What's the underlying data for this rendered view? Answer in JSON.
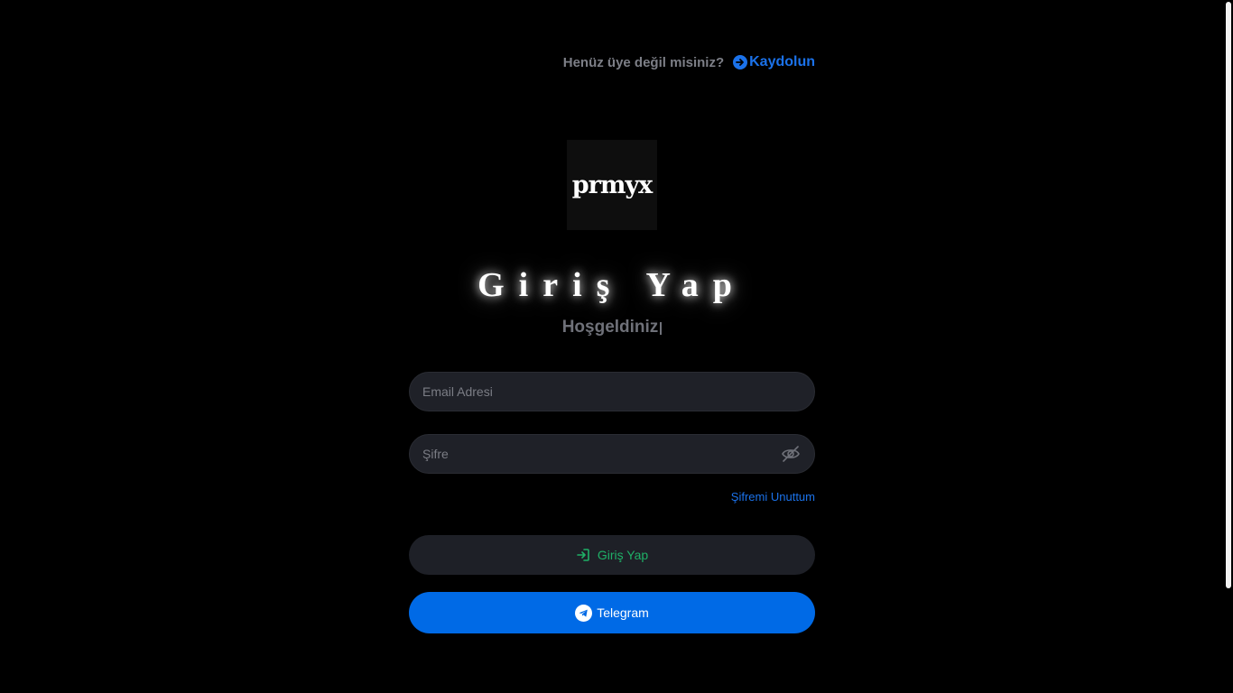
{
  "header": {
    "signup_question": "Henüz üye değil misiniz?",
    "signup_link": "Kaydolun"
  },
  "logo": {
    "text": "prmyx"
  },
  "title": "Giriş Yap",
  "subtitle": "Hoşgeldiniz",
  "form": {
    "email_placeholder": "Email Adresi",
    "email_value": "",
    "password_placeholder": "Şifre",
    "password_value": "",
    "forgot_label": "Şifremi Unuttum",
    "login_label": "Giriş Yap",
    "telegram_label": "Telegram"
  },
  "icons": {
    "signup": "arrow-right-circle-icon",
    "eye": "eye-slash-icon",
    "login": "sign-in-icon",
    "telegram": "telegram-icon"
  },
  "colors": {
    "background": "#000000",
    "accent_blue": "#1b72ea",
    "telegram_blue": "#006ae6",
    "login_green": "#1fb067",
    "input_bg": "#1f2128",
    "muted_text": "#7d7f87"
  }
}
